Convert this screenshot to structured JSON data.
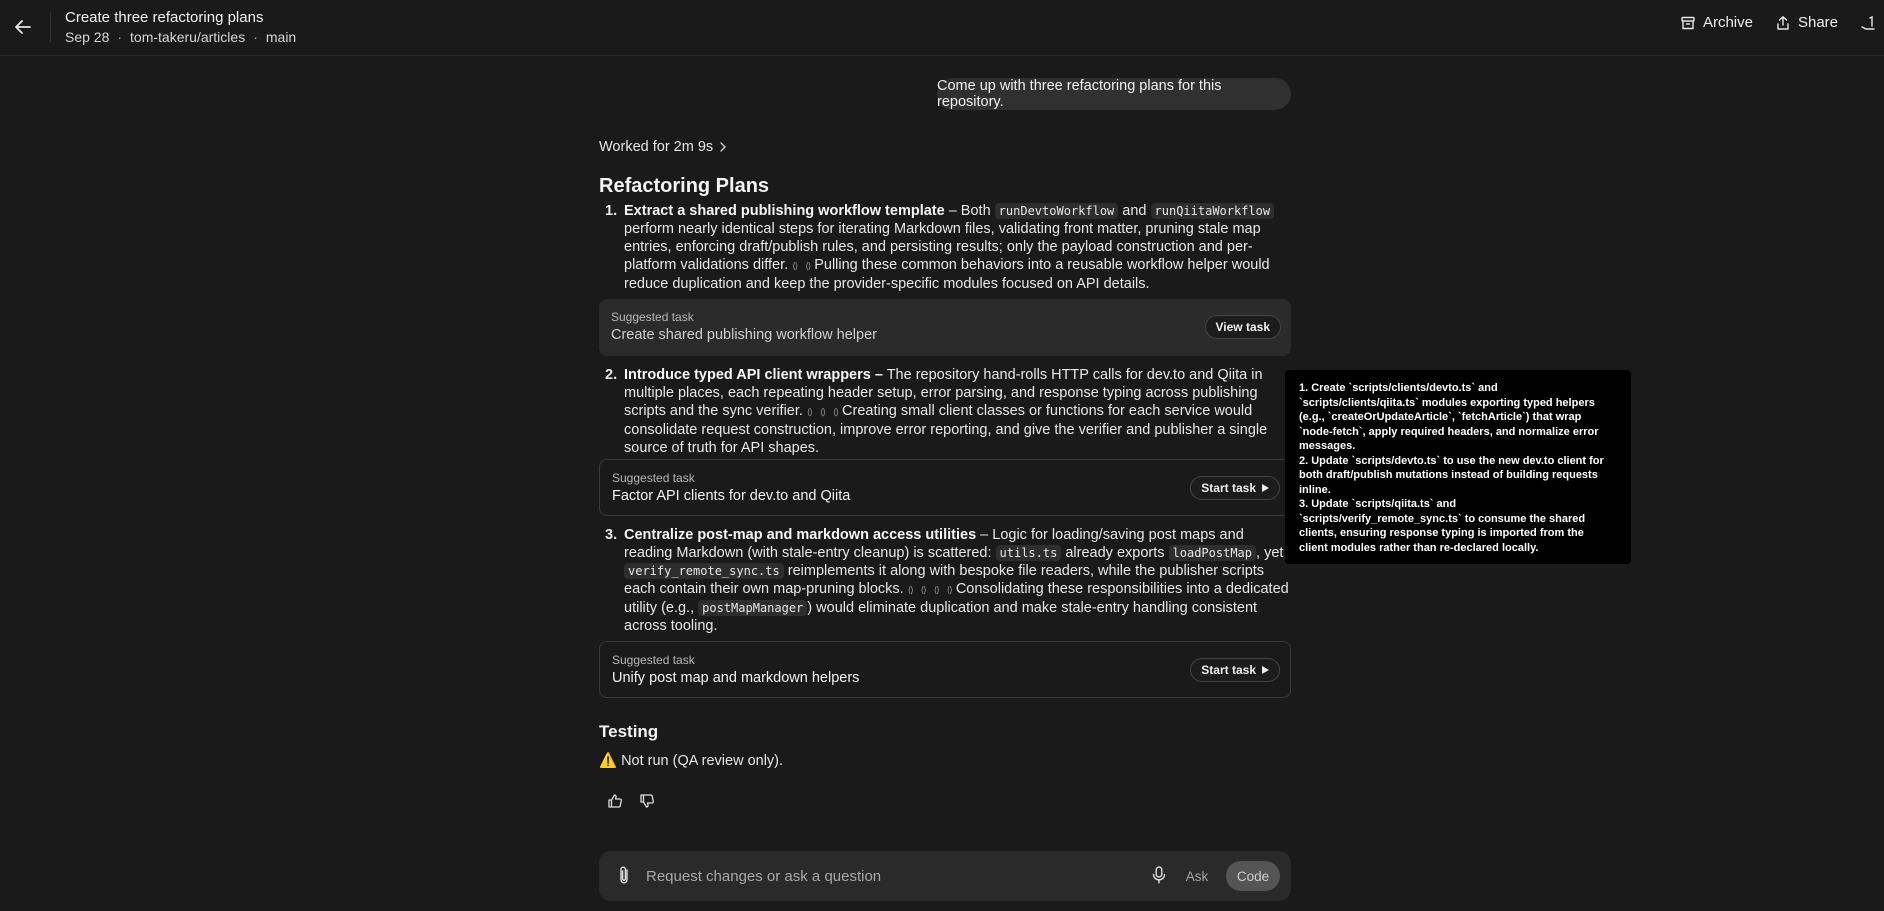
{
  "header": {
    "title": "Create three refactoring plans",
    "date": "Sep 28",
    "repo": "tom-takeru/articles",
    "branch": "main",
    "archive_label": "Archive",
    "share_label": "Share",
    "tail_label": "1"
  },
  "user_message": "Come up with three refactoring plans for this repository.",
  "worked_for": "Worked for 2m 9s",
  "heading": "Refactoring Plans",
  "plans": [
    {
      "num": "1.",
      "title": "Extract a shared publishing workflow template",
      "parts": [
        " – Both ",
        "runDevtoWorkflow",
        " and ",
        "runQiitaWorkflow",
        " perform nearly identical steps for iterating Markdown files, validating front matter, pruning stale map entries, enforcing draft/publish rules, and persisting results; only the payload construction and per-platform validations differ.",
        "Pulling these common behaviors into a reusable workflow helper would reduce duplication and keep the provider-specific modules focused on API details."
      ],
      "task_kicker": "Suggested task",
      "task_title": "Create shared publishing workflow helper",
      "task_button": "View task"
    },
    {
      "num": "2.",
      "title": "Introduce typed API client wrappers –",
      "parts": [
        " The repository hand-rolls HTTP calls for dev.to and Qiita in multiple places, each repeating header setup, error parsing, and response typing across publishing scripts and the sync verifier.",
        "Creating small client classes or functions for each service would consolidate request construction, improve error reporting, and give the verifier and publisher a single source of truth for API shapes."
      ],
      "task_kicker": "Suggested task",
      "task_title": "Factor API clients for dev.to and Qiita",
      "task_button": "Start task"
    },
    {
      "num": "3.",
      "title": "Centralize post-map and markdown access utilities",
      "parts": [
        " – Logic for loading/saving post maps and reading Markdown (with stale-entry cleanup) is scattered: ",
        "utils.ts",
        " already exports ",
        "loadPostMap",
        ", yet ",
        "verify_remote_sync.ts",
        " reimplements it along with bespoke file readers, while the publisher scripts each contain their own map-pruning blocks.",
        "Consolidating these responsibilities into a dedicated utility (e.g., ",
        "postMapManager",
        ") would eliminate duplication and make stale-entry handling consistent across tooling."
      ],
      "task_kicker": "Suggested task",
      "task_title": "Unify post map and markdown helpers",
      "task_button": "Start task"
    }
  ],
  "citation_glyph": "⟨⟩",
  "testing": {
    "heading": "Testing",
    "warning_icon": "⚠️",
    "text": "Not run (QA review only)."
  },
  "tooltip": {
    "lines": [
      "1. Create `scripts/clients/devto.ts` and",
      "`scripts/clients/qiita.ts` modules exporting typed helpers",
      "(e.g., `createOrUpdateArticle`, `fetchArticle`) that wrap",
      "`node-fetch`, apply required headers, and normalize error",
      "messages.",
      "2. Update `scripts/devto.ts` to use the new dev.to client for",
      "both draft/publish mutations instead of building requests",
      "inline.",
      "3. Update `scripts/qiita.ts` and",
      "`scripts/verify_remote_sync.ts` to consume the shared",
      "clients, ensuring response typing is imported from the",
      "client modules rather than re-declared locally."
    ]
  },
  "composer": {
    "placeholder": "Request changes or ask a question",
    "ask_label": "Ask",
    "code_label": "Code"
  }
}
